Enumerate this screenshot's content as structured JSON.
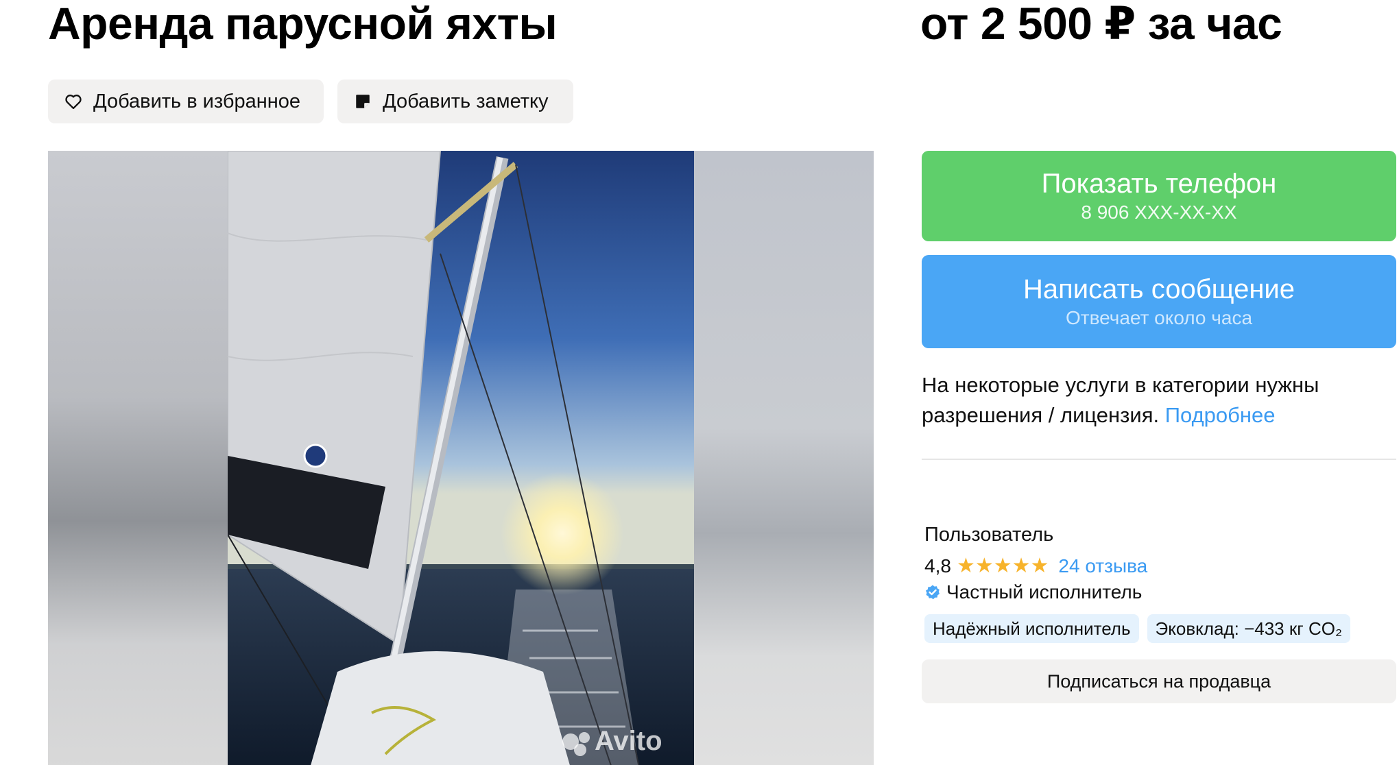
{
  "listing": {
    "title": "Аренда парусной яхты",
    "price": "от 2 500 ₽ за час"
  },
  "actions": {
    "favorite_label": "Добавить в избранное",
    "note_label": "Добавить заметку"
  },
  "contact": {
    "phone_button_label": "Показать телефон",
    "phone_masked": "8 906 XXX-XX-XX",
    "message_button_label": "Написать сообщение",
    "message_response_time": "Отвечает около часа"
  },
  "license_notice": {
    "text": "На некоторые услуги в категории нужны разрешения / лицензия.",
    "link_label": "Подробнее"
  },
  "seller": {
    "name": "Пользователь",
    "rating": "4,8",
    "stars": "★★★★★",
    "reviews_label": "24 отзыва",
    "type": "Частный исполнитель",
    "tags": [
      "Надёжный исполнитель",
      "Эковклад: −433 кг CO₂"
    ],
    "subscribe_label": "Подписаться на продавца"
  },
  "gallery": {
    "watermark": "Avito"
  },
  "colors": {
    "phone_button": "#5fcf6b",
    "message_button": "#4aa6f5",
    "link": "#3a9af2",
    "star": "#f7b32b",
    "chip_bg": "#f2f1f0",
    "tag_bg": "#e5f2fd"
  },
  "icons": {
    "favorite": "heart-outline-icon",
    "note": "note-icon",
    "verified": "verified-check-icon"
  }
}
